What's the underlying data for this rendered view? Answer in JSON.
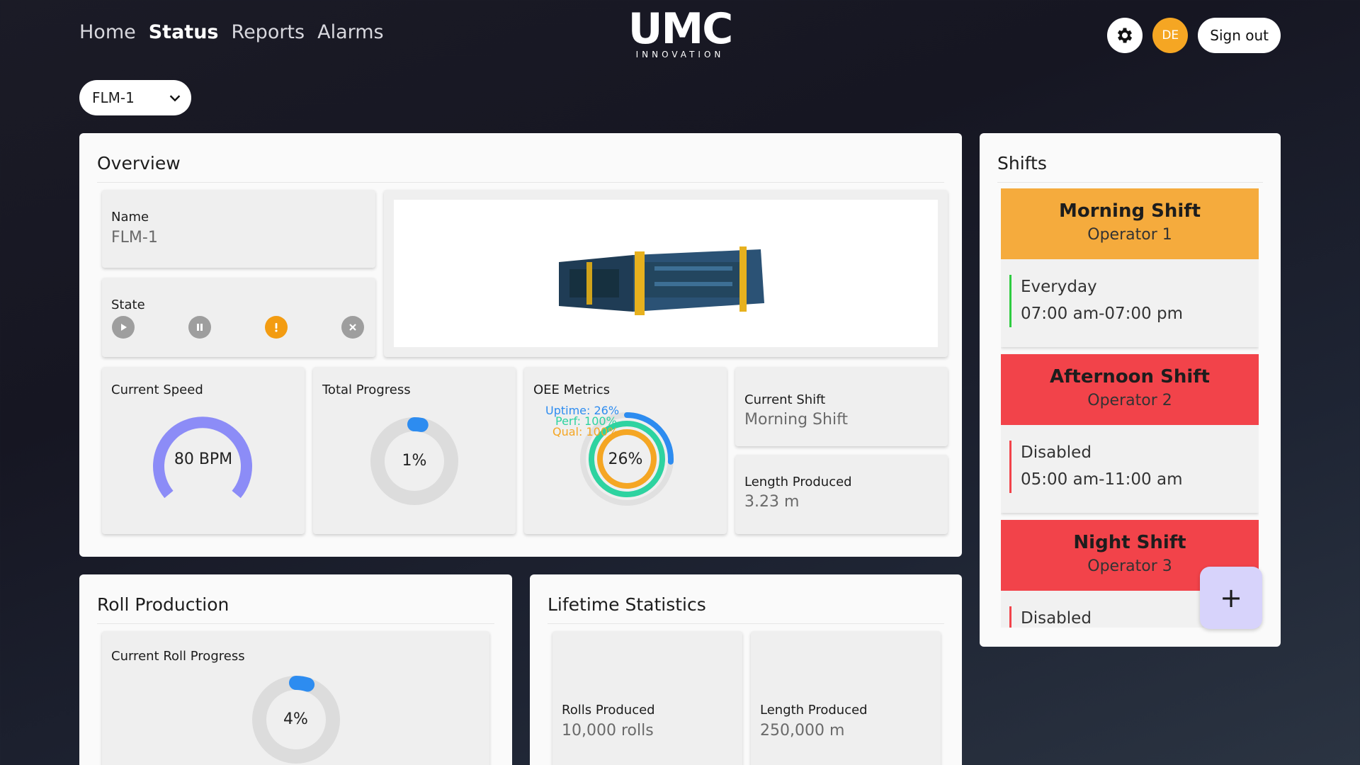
{
  "nav": {
    "home": "Home",
    "status": "Status",
    "reports": "Reports",
    "alarms": "Alarms"
  },
  "logo": {
    "mark": "UMC",
    "sub": "INNOVATION"
  },
  "header": {
    "avatar_initials": "DE",
    "signout_label": "Sign out"
  },
  "machine_select": {
    "value": "FLM-1"
  },
  "overview": {
    "title": "Overview",
    "name_label": "Name",
    "name_value": "FLM-1",
    "state_label": "State",
    "state_icons": [
      "play-icon",
      "pause-icon",
      "warning-icon",
      "stop-icon"
    ],
    "active_state": "warning",
    "speed_label": "Current Speed",
    "speed_value": "80 BPM",
    "progress_label": "Total Progress",
    "progress_value": "1%",
    "progress_fraction": 0.01,
    "oee_label": "OEE Metrics",
    "oee_uptime": "Uptime: 26%",
    "oee_perf": "Perf: 100%",
    "oee_qual": "Qual: 100%",
    "oee_value": "26%",
    "oee_fractions": {
      "uptime": 0.26,
      "perf": 1.0,
      "qual": 1.0
    },
    "current_shift_label": "Current Shift",
    "current_shift_value": "Morning Shift",
    "length_label": "Length Produced",
    "length_value": "3.23 m"
  },
  "shifts": {
    "title": "Shifts",
    "items": [
      {
        "name": "Morning Shift",
        "operator": "Operator 1",
        "days": "Everyday",
        "hours": "07:00 am-07:00 pm",
        "color": "#f5ab3d",
        "bar": "#2ecc40"
      },
      {
        "name": "Afternoon Shift",
        "operator": "Operator 2",
        "days": "Disabled",
        "hours": "05:00 am-11:00 am",
        "color": "#f2434a",
        "bar": "#f2434a"
      },
      {
        "name": "Night Shift",
        "operator": "Operator 3",
        "days": "Disabled",
        "color": "#f2434a",
        "bar": "#f2434a"
      }
    ],
    "add_label": "+"
  },
  "roll": {
    "title": "Roll Production",
    "progress_label": "Current Roll Progress",
    "progress_value": "4%",
    "progress_fraction": 0.04
  },
  "lifetime": {
    "title": "Lifetime Statistics",
    "rolls_label": "Rolls Produced",
    "rolls_value": "10,000 rolls",
    "length_label": "Length Produced",
    "length_value": "250,000 m"
  }
}
